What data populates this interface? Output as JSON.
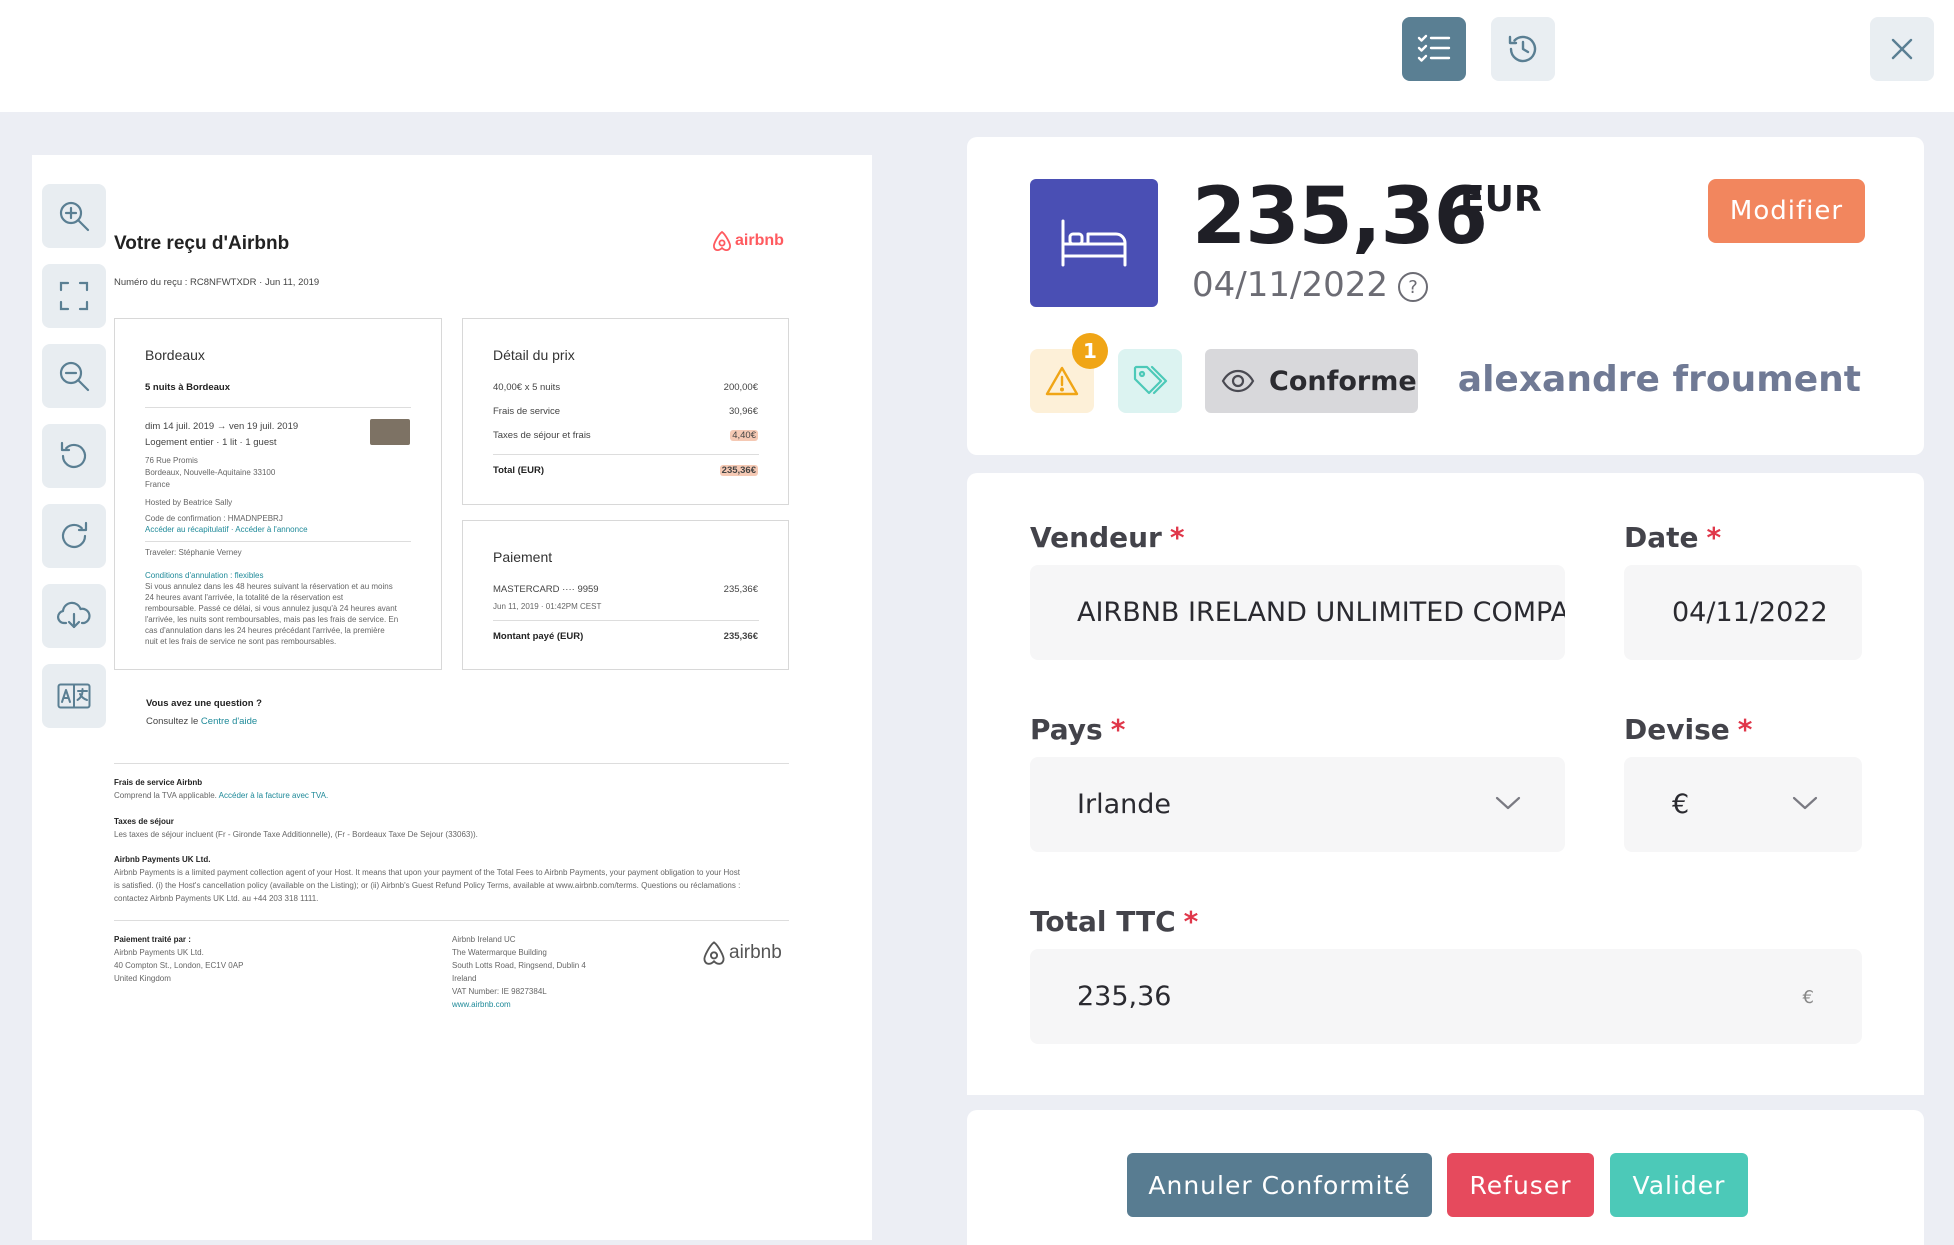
{
  "receipt": {
    "title": "Votre reçu d'Airbnb",
    "number_line": "Numéro du reçu : RC8NFWTXDR · Jun 11, 2019",
    "logo_text": "airbnb",
    "stay": {
      "city": "Bordeaux",
      "nights": "5 nuits à Bordeaux",
      "dates": "dim 14 juil. 2019  →  ven 19 juil. 2019",
      "lodging": "Logement entier · 1 lit · 1 guest",
      "address1": "76 Rue Promis",
      "address2": "Bordeaux, Nouvelle-Aquitaine 33100",
      "address3": "France",
      "host": "Hosted by Beatrice Sally",
      "confirmation": "Code de confirmation : HMADNPEBRJ",
      "links": "Accéder au récapitulatif · Accéder à l'annonce",
      "traveler": "Traveler: Stéphanie Verney",
      "cancel_title": "Conditions d'annulation : flexibles",
      "cancel_lines": [
        "Si vous annulez dans les 48 heures suivant la réservation et au moins",
        "24 heures avant l'arrivée, la totalité de la réservation est",
        "remboursable. Passé ce délai, si vous annulez jusqu'à 24 heures avant",
        "l'arrivée, les nuits sont remboursables, mais pas les frais de service. En",
        "cas d'annulation dans les 24 heures précédant l'arrivée, la première",
        "nuit et les frais de service ne sont pas remboursables."
      ]
    },
    "price": {
      "title": "Détail du prix",
      "rows": [
        {
          "label": "40,00€ x 5 nuits",
          "value": "200,00€"
        },
        {
          "label": "Frais de service",
          "value": "30,96€"
        },
        {
          "label": "Taxes de séjour et frais",
          "value": "4,40€"
        }
      ],
      "total_label": "Total (EUR)",
      "total_value": "235,36€"
    },
    "payment": {
      "title": "Paiement",
      "card": "MASTERCARD ···· 9959",
      "card_value": "235,36€",
      "card_date": "Jun 11, 2019 · 01:42PM CEST",
      "paid_label": "Montant payé (EUR)",
      "paid_value": "235,36€"
    },
    "question": "Vous avez une question ?",
    "help_prefix": "Consultez le ",
    "help_link": "Centre d'aide",
    "fees_title": "Frais de service Airbnb",
    "fees_text": "Comprend la TVA applicable. ",
    "fees_link": "Accéder à la facture avec TVA.",
    "taxes_title": "Taxes de séjour",
    "taxes_text": "Les taxes de séjour incluent (Fr - Gironde Taxe Additionnelle), (Fr - Bordeaux Taxe De Sejour (33063)).",
    "payments_title": "Airbnb Payments UK Ltd.",
    "payments_lines": [
      "Airbnb Payments is a limited payment collection agent of your Host. It means that upon your payment of the Total Fees to Airbnb Payments, your payment obligation to your Host",
      "is satisfied. (i) the Host's cancellation policy (available on the Listing); or (ii) Airbnb's Guest Refund Policy Terms, available at www.airbnb.com/terms. Questions ou réclamations :",
      "contactez Airbnb Payments UK Ltd. au +44 203 318 1111."
    ],
    "footer_left": [
      "Paiement traité par :",
      "Airbnb Payments UK Ltd.",
      "40 Compton St., London, EC1V 0AP",
      "United Kingdom"
    ],
    "footer_mid": [
      "Airbnb Ireland UC",
      "The Watermarque Building",
      "South Lotts Road, Ringsend, Dublin 4",
      "Ireland",
      "VAT Number: IE 9827384L",
      "www.airbnb.com"
    ]
  },
  "summary": {
    "amount": "235,36",
    "currency": "EUR",
    "date": "04/11/2022",
    "modify_label": "Modifier",
    "warning_count": "1",
    "status_label": "Conforme",
    "user_name": "alexandre froument"
  },
  "form": {
    "vendor_label": "Vendeur",
    "vendor_value": "AIRBNB IRELAND UNLIMITED COMPANY",
    "date_label": "Date",
    "date_value": "04/11/2022",
    "country_label": "Pays",
    "country_value": "Irlande",
    "currency_label": "Devise",
    "currency_value": "€",
    "total_label": "Total TTC",
    "total_value": "235,36",
    "total_suffix": "€",
    "required_mark": "*"
  },
  "actions": {
    "cancel_label": "Annuler Conformité",
    "reject_label": "Refuser",
    "validate_label": "Valider"
  },
  "colors": {
    "primary": "#5a7f93",
    "accent_orange": "#f2865e",
    "bed_blue": "#4a4fb4",
    "danger": "#e64a5d",
    "success": "#4cc9b8",
    "warning": "#f0a516"
  },
  "icons": [
    "checklist-icon",
    "history-icon",
    "close-icon",
    "zoom-in-icon",
    "fullscreen-icon",
    "zoom-out-icon",
    "rotate-left-icon",
    "rotate-right-icon",
    "download-icon",
    "translate-icon",
    "bed-icon",
    "warning-icon",
    "tag-icon",
    "eye-icon",
    "help-icon",
    "chevron-down-icon"
  ]
}
